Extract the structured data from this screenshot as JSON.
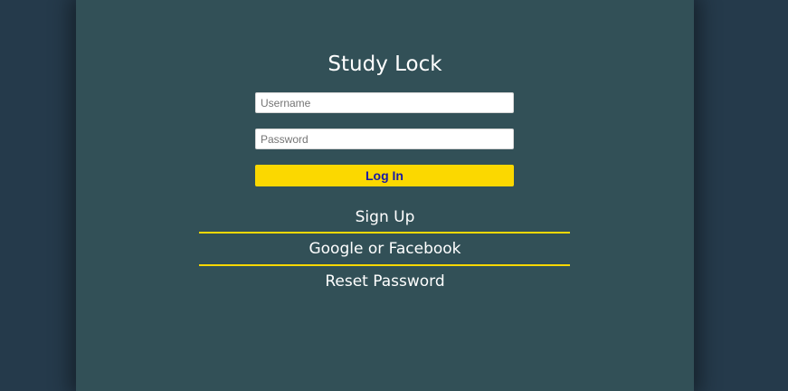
{
  "app": {
    "title": "Study Lock"
  },
  "form": {
    "username_placeholder": "Username",
    "username_value": "",
    "password_placeholder": "Password",
    "password_value": "",
    "login_label": "Log In"
  },
  "links": {
    "signup": "Sign Up",
    "social": "Google or Facebook",
    "reset": "Reset Password"
  },
  "colors": {
    "page_background": "#253a4b",
    "panel_background": "#325057",
    "accent_yellow": "#fbd800",
    "login_text": "#1a1aa6",
    "text": "#ffffff"
  }
}
